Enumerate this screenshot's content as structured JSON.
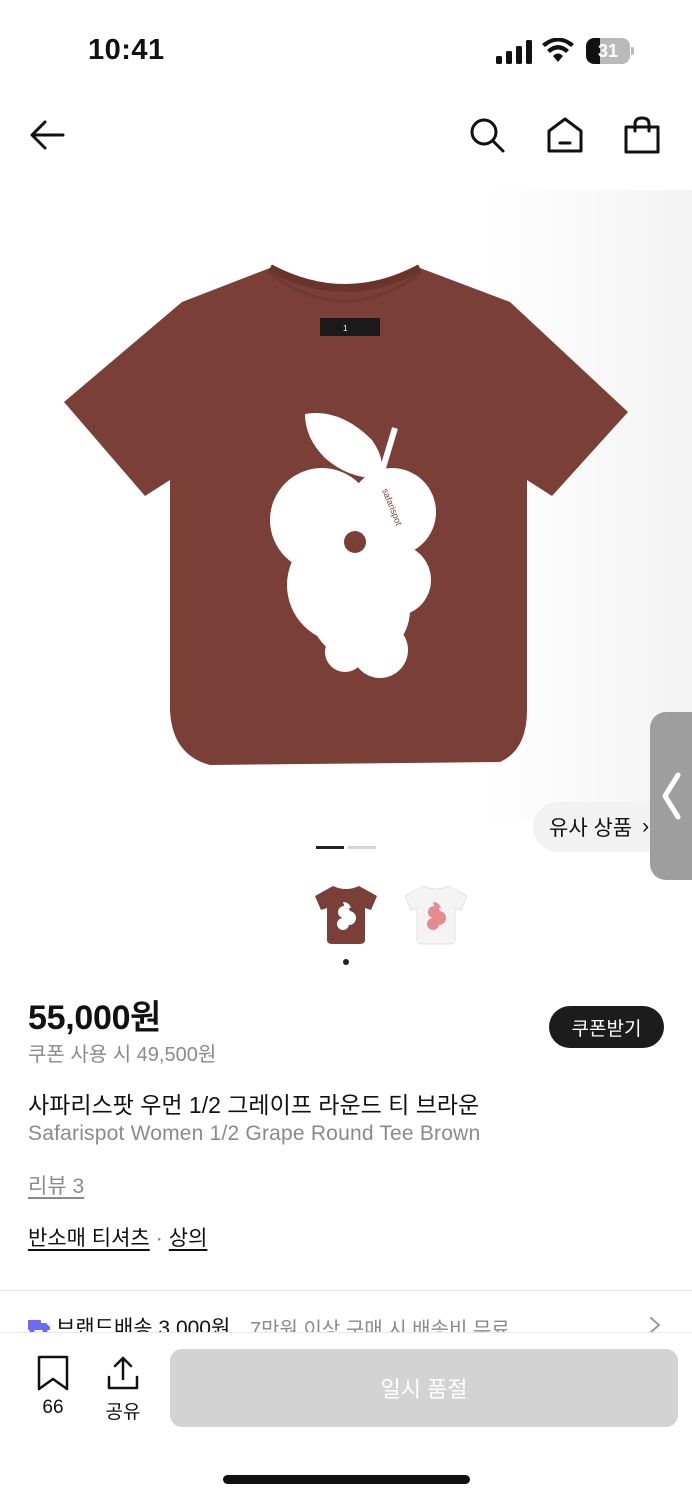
{
  "status_bar": {
    "time": "10:41",
    "battery": "31",
    "battery_fraction": 0.31
  },
  "similar": {
    "label": "유사 상품",
    "chevron": "›"
  },
  "gallery": {
    "current_index": 1,
    "total": 2
  },
  "product": {
    "price": "55,000원",
    "coupon_price": "쿠폰 사용 시 49,500원",
    "coupon_button": "쿠폰받기",
    "title_ko": "사파리스팟 우먼 1/2 그레이프 라운드 티 브라운",
    "title_en": "Safarispot Women 1/2 Grape Round Tee Brown",
    "review_link": "리뷰 3",
    "category": [
      "반소매 티셔츠",
      "상의"
    ],
    "category_sep": "·",
    "tee_label": "1",
    "brand_print": "safarispot"
  },
  "delivery": {
    "main": "브랜드배송 3,000원",
    "sub": "7만원 이상 구매 시 배송비 무료"
  },
  "bottom_bar": {
    "bookmark_count": "66",
    "share_label": "공유",
    "soldout_label": "일시 품절"
  },
  "colors": {
    "tee_brown": "#7a3f36",
    "print_white": "#ffffff",
    "print_pink": "#e58a8d",
    "accent_dark": "#1c1c1c",
    "disabled": "#d3d3d3",
    "delivery_icon": "#6d6af2"
  },
  "icons": [
    "back-arrow-icon",
    "search-icon",
    "home-icon",
    "shopping-bag-icon",
    "bookmark-icon",
    "share-icon",
    "truck-icon",
    "chevron-right-icon",
    "chevron-left-icon"
  ]
}
